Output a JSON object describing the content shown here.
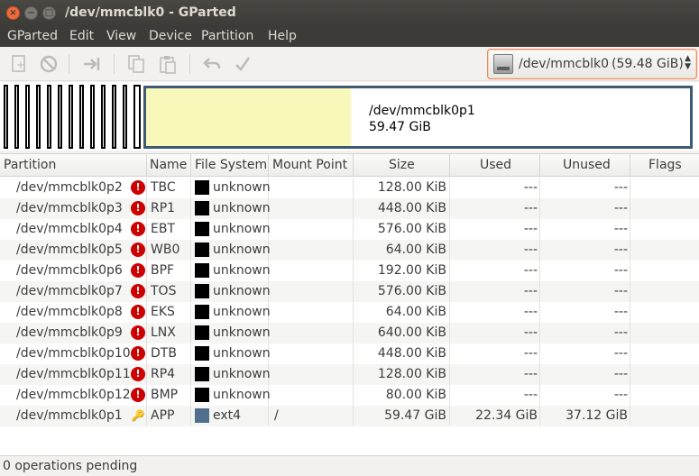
{
  "window": {
    "title": "/dev/mmcblk0 - GParted"
  },
  "menu": [
    "GParted",
    "Edit",
    "View",
    "Device",
    "Partition",
    "Help"
  ],
  "toolbar": {
    "icons": [
      "new-partition-icon",
      "delete-icon",
      "resize-move-icon",
      "copy-icon",
      "paste-icon",
      "undo-icon",
      "apply-icon"
    ]
  },
  "device": {
    "name": "/dev/mmcblk0",
    "size": "(59.48 GiB)"
  },
  "graph": {
    "partition_name": "/dev/mmcblk0p1",
    "partition_size": "59.47 GiB",
    "used_fraction": 0.376
  },
  "columns": [
    "Partition",
    "Name",
    "File System",
    "Mount Point",
    "Size",
    "Used",
    "Unused",
    "Flags"
  ],
  "rows": [
    {
      "partition": "/dev/mmcblk0p2",
      "status": "error",
      "name": "TBC",
      "fs": "unknown",
      "fs_color": "#000000",
      "mount": "",
      "size": "128.00 KiB",
      "used": "---",
      "unused": "---",
      "flags": ""
    },
    {
      "partition": "/dev/mmcblk0p3",
      "status": "error",
      "name": "RP1",
      "fs": "unknown",
      "fs_color": "#000000",
      "mount": "",
      "size": "448.00 KiB",
      "used": "---",
      "unused": "---",
      "flags": ""
    },
    {
      "partition": "/dev/mmcblk0p4",
      "status": "error",
      "name": "EBT",
      "fs": "unknown",
      "fs_color": "#000000",
      "mount": "",
      "size": "576.00 KiB",
      "used": "---",
      "unused": "---",
      "flags": ""
    },
    {
      "partition": "/dev/mmcblk0p5",
      "status": "error",
      "name": "WB0",
      "fs": "unknown",
      "fs_color": "#000000",
      "mount": "",
      "size": "64.00 KiB",
      "used": "---",
      "unused": "---",
      "flags": ""
    },
    {
      "partition": "/dev/mmcblk0p6",
      "status": "error",
      "name": "BPF",
      "fs": "unknown",
      "fs_color": "#000000",
      "mount": "",
      "size": "192.00 KiB",
      "used": "---",
      "unused": "---",
      "flags": ""
    },
    {
      "partition": "/dev/mmcblk0p7",
      "status": "error",
      "name": "TOS",
      "fs": "unknown",
      "fs_color": "#000000",
      "mount": "",
      "size": "576.00 KiB",
      "used": "---",
      "unused": "---",
      "flags": ""
    },
    {
      "partition": "/dev/mmcblk0p8",
      "status": "error",
      "name": "EKS",
      "fs": "unknown",
      "fs_color": "#000000",
      "mount": "",
      "size": "64.00 KiB",
      "used": "---",
      "unused": "---",
      "flags": ""
    },
    {
      "partition": "/dev/mmcblk0p9",
      "status": "error",
      "name": "LNX",
      "fs": "unknown",
      "fs_color": "#000000",
      "mount": "",
      "size": "640.00 KiB",
      "used": "---",
      "unused": "---",
      "flags": ""
    },
    {
      "partition": "/dev/mmcblk0p10",
      "status": "error",
      "name": "DTB",
      "fs": "unknown",
      "fs_color": "#000000",
      "mount": "",
      "size": "448.00 KiB",
      "used": "---",
      "unused": "---",
      "flags": ""
    },
    {
      "partition": "/dev/mmcblk0p11",
      "status": "error",
      "name": "RP4",
      "fs": "unknown",
      "fs_color": "#000000",
      "mount": "",
      "size": "128.00 KiB",
      "used": "---",
      "unused": "---",
      "flags": ""
    },
    {
      "partition": "/dev/mmcblk0p12",
      "status": "error",
      "name": "BMP",
      "fs": "unknown",
      "fs_color": "#000000",
      "mount": "",
      "size": "80.00 KiB",
      "used": "---",
      "unused": "---",
      "flags": ""
    },
    {
      "partition": "/dev/mmcblk0p1",
      "status": "mounted",
      "name": "APP",
      "fs": "ext4",
      "fs_color": "#4f6f8c",
      "mount": "/",
      "size": "59.47 GiB",
      "used": "22.34 GiB",
      "unused": "37.12 GiB",
      "flags": ""
    }
  ],
  "status": {
    "text": "0 operations pending"
  },
  "colors": {
    "accent": "#e98b5e",
    "titlebar": "#3c3b37",
    "used_fill": "#f8f8ba",
    "partition_border": "#3f5b73"
  }
}
